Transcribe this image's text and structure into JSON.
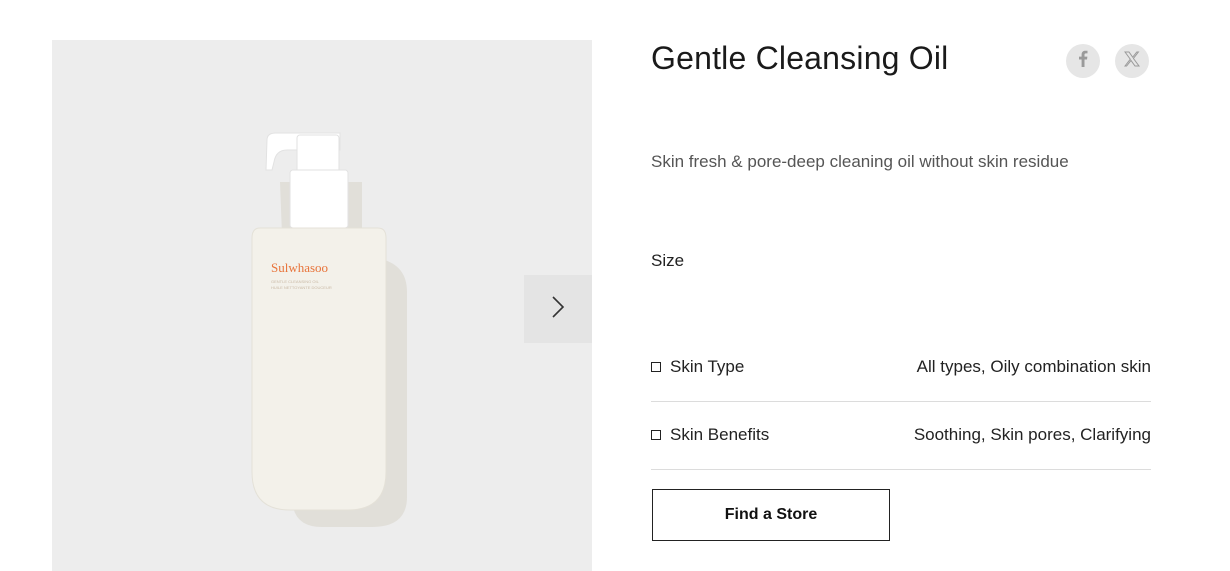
{
  "product": {
    "title": "Gentle Cleansing Oil",
    "description": "Skin fresh & pore-deep cleaning oil without skin residue",
    "size_label": "Size",
    "brand_on_bottle": "Sulwhasoo",
    "bottle_small_text_1": "GENTLE CLEANSING OIL",
    "bottle_small_text_2": "HUILE NETTOYANTE DOUCEUR"
  },
  "share": {
    "facebook_icon": "facebook-icon",
    "x_icon": "x-icon"
  },
  "gallery": {
    "next_icon": "chevron-right-icon"
  },
  "attributes": [
    {
      "label": "Skin Type",
      "value": "All types, Oily combination skin"
    },
    {
      "label": "Skin Benefits",
      "value": "Soothing, Skin pores, Clarifying"
    }
  ],
  "actions": {
    "find_store": "Find a Store"
  },
  "colors": {
    "brand_orange": "#e8743b",
    "gallery_bg": "#ededed"
  }
}
